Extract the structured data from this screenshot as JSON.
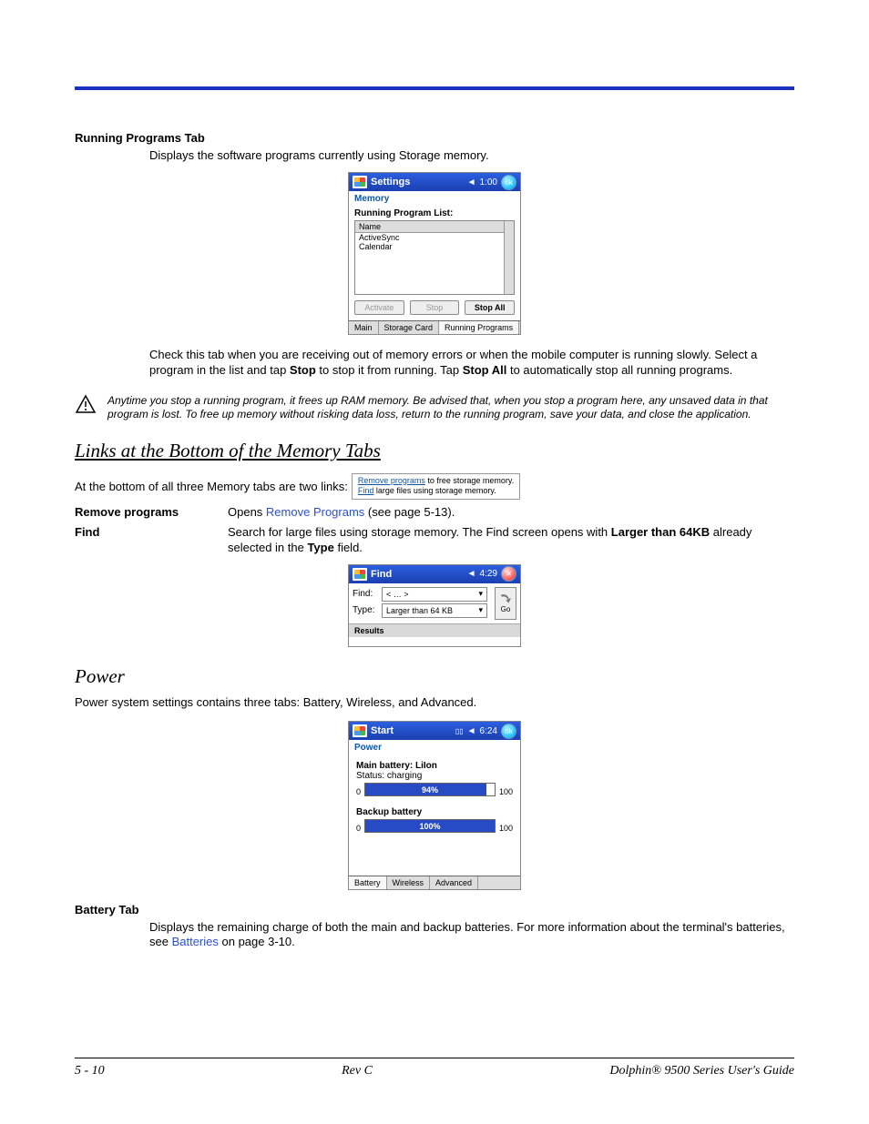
{
  "sections": {
    "running_heading": "Running Programs Tab",
    "running_intro": "Displays the software programs currently using Storage memory.",
    "running_para1_a": "Check this tab when you are receiving out of memory errors or when the mobile computer is running slowly. Select a program in the list and tap ",
    "running_para1_b": " to stop it from running. Tap ",
    "running_para1_c": " to automatically stop all running programs.",
    "stop_bold": "Stop",
    "stopall_bold": "Stop All",
    "warning": "Anytime you stop a running program, it frees up RAM memory. Be advised that, when you stop a program here, any unsaved data in that program is lost. To free up memory without risking data loss, return to the running program, save your data, and close the application.",
    "links_heading": "Links at the Bottom of the Memory Tabs",
    "links_intro": "At the bottom of all three Memory tabs are two links:",
    "links_box": {
      "l1a": "Remove programs",
      "l1b": " to free storage memory.",
      "l2a": "Find",
      "l2b": " large files using storage memory."
    },
    "remove_term": "Remove programs",
    "remove_desc_a": "Opens ",
    "remove_desc_link": "Remove Programs",
    "remove_desc_b": " (see page 5-13).",
    "find_term": "Find",
    "find_desc_a": "Search for large files using storage memory. The Find screen opens with ",
    "find_desc_bold": "Larger than 64KB",
    "find_desc_b": " already selected in the ",
    "find_desc_bold2": "Type",
    "find_desc_c": " field.",
    "power_heading": "Power",
    "power_intro": "Power system settings contains three tabs: Battery, Wireless, and Advanced.",
    "battery_heading": "Battery Tab",
    "battery_desc_a": "Displays the remaining charge of both the main and backup batteries. For more information about the terminal's batteries, see ",
    "battery_desc_link": "Batteries",
    "battery_desc_b": " on page 3-10."
  },
  "shot_memory": {
    "title": "Settings",
    "time": "1:00",
    "sub": "Memory",
    "list_label": "Running Program List:",
    "col": "Name",
    "items": [
      "ActiveSync",
      "Calendar"
    ],
    "btns": {
      "activate": "Activate",
      "stop": "Stop",
      "stopall": "Stop All"
    },
    "tabs": [
      "Main",
      "Storage Card",
      "Running Programs"
    ]
  },
  "shot_find": {
    "title": "Find",
    "time": "4:29",
    "find_label": "Find:",
    "find_value": "< … >",
    "type_label": "Type:",
    "type_value": "Larger than 64 KB",
    "go": "Go",
    "results": "Results"
  },
  "shot_power": {
    "title": "Start",
    "time": "6:24",
    "sub": "Power",
    "main_label": "Main battery: LiIon",
    "status": "Status: charging",
    "main_pct": "94%",
    "main_pct_val": 94,
    "backup_label": "Backup battery",
    "backup_pct": "100%",
    "backup_pct_val": 100,
    "zero": "0",
    "hundred": "100",
    "tabs": [
      "Battery",
      "Wireless",
      "Advanced"
    ]
  },
  "footer": {
    "left": "5 - 10",
    "center": "Rev C",
    "right": "Dolphin® 9500 Series User's Guide"
  },
  "icons": {
    "speaker": "◄",
    "ok": "ok",
    "close": "✕",
    "signal": "▯▯"
  }
}
